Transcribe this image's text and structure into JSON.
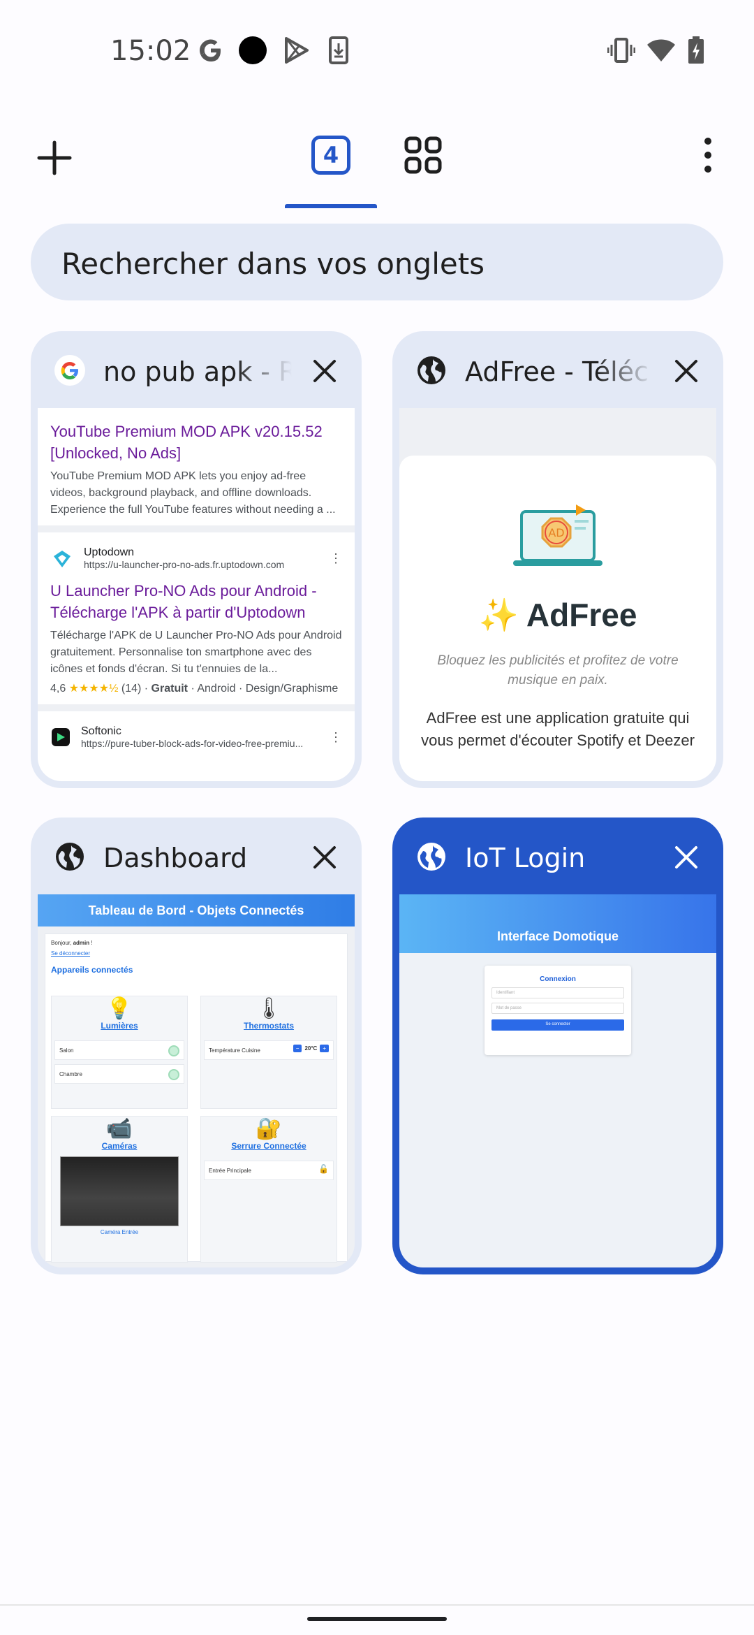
{
  "status_bar": {
    "time": "15:02",
    "icons": [
      "google-g-icon",
      "record-dot-icon",
      "play-store-icon",
      "download-icon",
      "vibrate-icon",
      "wifi-icon",
      "battery-charging-icon"
    ]
  },
  "toolbar": {
    "tab_count": "4",
    "accent_color": "#2456c8",
    "icons": [
      "plus-icon",
      "tab-switcher-icon",
      "tab-groups-icon",
      "more-vert-icon"
    ]
  },
  "search": {
    "placeholder": "Rechercher dans vos onglets"
  },
  "tabs": [
    {
      "title": "no pub apk - R",
      "favicon": "google-icon",
      "results": [
        {
          "link": "YouTube Premium MOD APK v20.15.52 [Unlocked, No Ads]",
          "snippet": "YouTube Premium MOD APK lets you enjoy ad-free videos, background playback, and offline downloads. Experience the full YouTube features without needing a ..."
        },
        {
          "source": "Uptodown",
          "url": "https://u-launcher-pro-no-ads.fr.uptodown.com",
          "link": "U Launcher Pro-NO Ads pour Android - Télécharge l'APK à partir d'Uptodown",
          "snippet": "Télécharge l'APK de U Launcher Pro-NO Ads pour Android gratuitement. Personnalise ton smartphone avec des icônes et fonds d'écran. Si tu t'ennuies de la...",
          "rating": "4,6",
          "stars": "★★★★½",
          "reviews": "(14)",
          "price": "Gratuit",
          "meta": "· Android · Design/Graphisme"
        },
        {
          "source": "Softonic",
          "url": "https://pure-tuber-block-ads-for-video-free-premiu..."
        }
      ]
    },
    {
      "title": "AdFree - Téléc",
      "favicon": "globe-icon",
      "app_name": "✨ AdFree",
      "tagline": "Bloquez les publicités et profitez de votre musique en paix.",
      "description": "AdFree est une application gratuite qui vous permet d'écouter Spotify et Deezer"
    },
    {
      "title": "Dashboard",
      "favicon": "globe-icon",
      "header": "Tableau de Bord - Objets Connectés",
      "greeting_prefix": "Bonjour, ",
      "user": "admin",
      "greeting_suffix": " !",
      "logout": "Se déconnecter",
      "section": "Appareils connectés",
      "lights": {
        "title": "Lumières",
        "rows": [
          "Salon",
          "Chambre"
        ]
      },
      "thermostats": {
        "title": "Thermostats",
        "row": "Température Cuisine",
        "value": "20°C",
        "minus": "−",
        "plus": "+"
      },
      "cameras": {
        "title": "Caméras",
        "caption": "Caméra Entrée"
      },
      "lock": {
        "title": "Serrure Connectée",
        "row": "Entrée Principale"
      }
    },
    {
      "title": "IoT Login",
      "favicon": "globe-icon",
      "selected": true,
      "header": "Interface Domotique",
      "form_title": "Connexion",
      "username_placeholder": "Identifiant",
      "password_placeholder": "Mot de passe",
      "submit": "Se connecter"
    }
  ]
}
